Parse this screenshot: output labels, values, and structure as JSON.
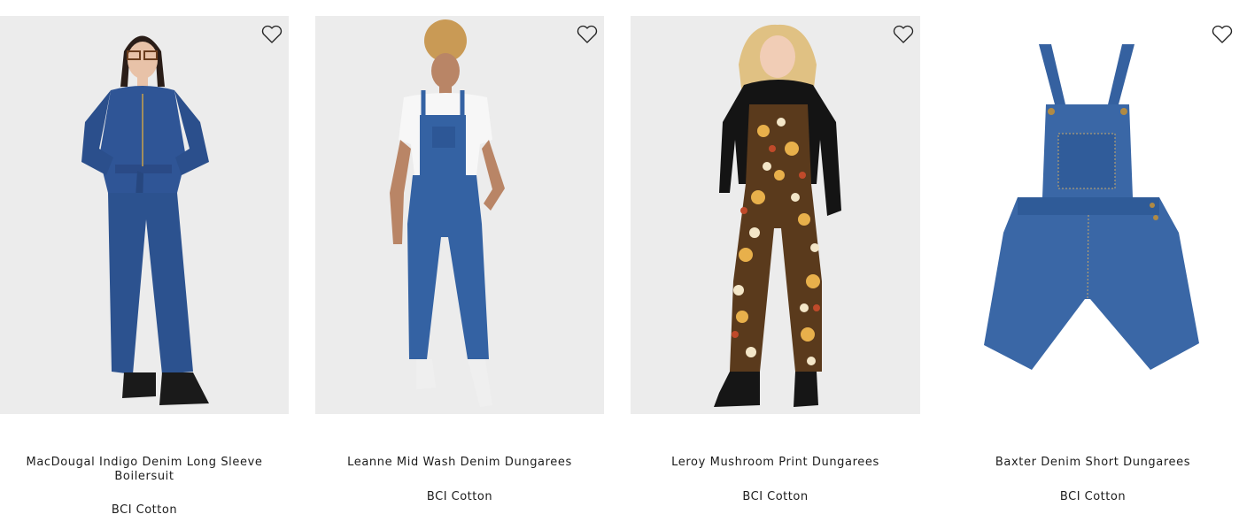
{
  "products": [
    {
      "title": "MacDougal Indigo Denim Long Sleeve Boilersuit",
      "material": "BCI Cotton",
      "image_icon": "model-denim-boilersuit-image",
      "wishlist_icon": "heart-outline-icon"
    },
    {
      "title": "Leanne Mid Wash Denim Dungarees",
      "material": "BCI Cotton",
      "image_icon": "model-denim-dungarees-image",
      "wishlist_icon": "heart-outline-icon"
    },
    {
      "title": "Leroy Mushroom Print Dungarees",
      "material": "BCI Cotton",
      "image_icon": "model-mushroom-print-dungarees-image",
      "wishlist_icon": "heart-outline-icon"
    },
    {
      "title": "Baxter Denim Short Dungarees",
      "material": "BCI Cotton",
      "image_icon": "denim-short-dungarees-image",
      "wishlist_icon": "heart-outline-icon"
    }
  ],
  "colors": {
    "denim": "#2f5596",
    "background": "#ececec",
    "text": "#1c1c1c"
  }
}
